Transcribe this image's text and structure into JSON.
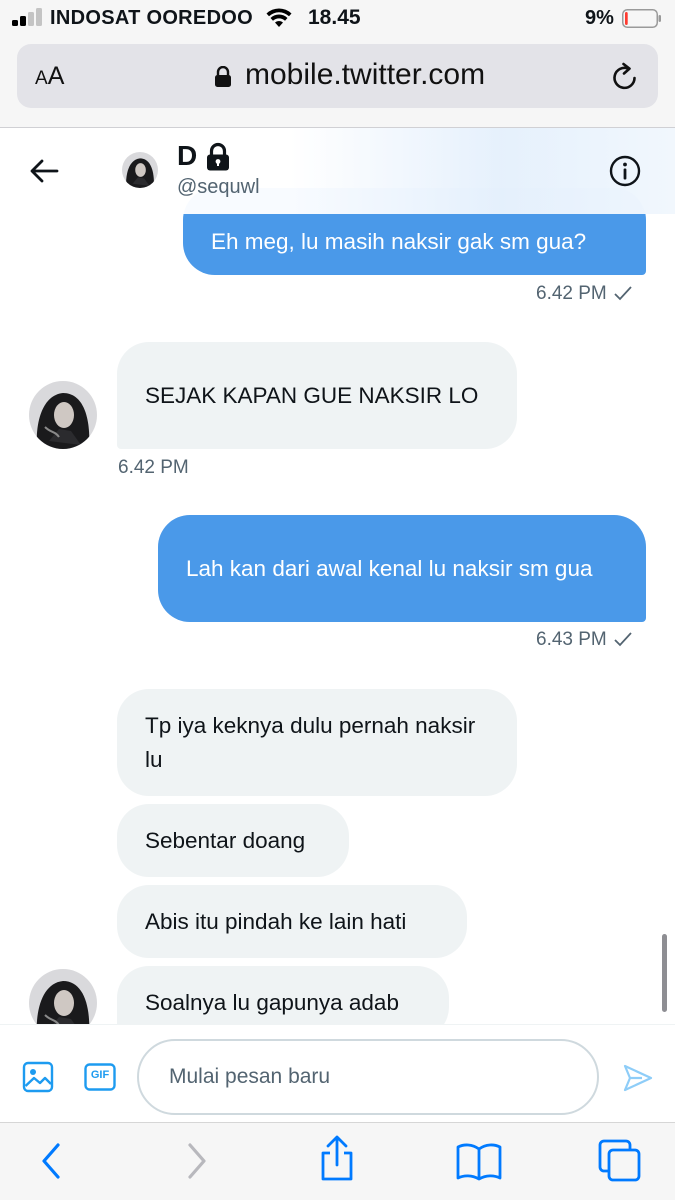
{
  "status_bar": {
    "carrier": "INDOSAT OOREDOO",
    "time": "18.45",
    "battery": "9%",
    "battery_level": 0.09,
    "battery_color": "#ff3b30"
  },
  "browser": {
    "text_size_label": "AA",
    "url": "mobile.twitter.com"
  },
  "conversation": {
    "name": "D",
    "handle": "@sequwl",
    "locked": true,
    "accent": "#4a99e9"
  },
  "messages": [
    {
      "side": "sent",
      "text": "Eh meg, lu masih naksir gak sm gua?",
      "time": "6.42 PM",
      "read": true
    },
    {
      "side": "received",
      "text": "SEJAK KAPAN GUE NAKSIR LO",
      "time": "6.42 PM"
    },
    {
      "side": "sent",
      "text": "Lah kan dari awal kenal lu naksir sm gua",
      "time": "6.43 PM",
      "read": true
    },
    {
      "side": "received",
      "text": "Tp iya keknya dulu pernah naksir lu"
    },
    {
      "side": "received",
      "text": "Sebentar doang"
    },
    {
      "side": "received",
      "text": "Abis itu pindah ke lain hati"
    },
    {
      "side": "received",
      "text": "Soalnya lu gapunya adab"
    }
  ],
  "composer": {
    "placeholder": "Mulai pesan baru",
    "gif_label": "GIF"
  },
  "icons": {
    "back": "arrow-left-icon",
    "info": "info-icon",
    "media": "image-icon",
    "gif": "gif-icon",
    "send": "send-icon",
    "reload": "reload-icon",
    "toolbar": [
      "chevron-left-icon",
      "chevron-right-icon",
      "share-icon",
      "bookmarks-icon",
      "tabs-icon"
    ]
  }
}
